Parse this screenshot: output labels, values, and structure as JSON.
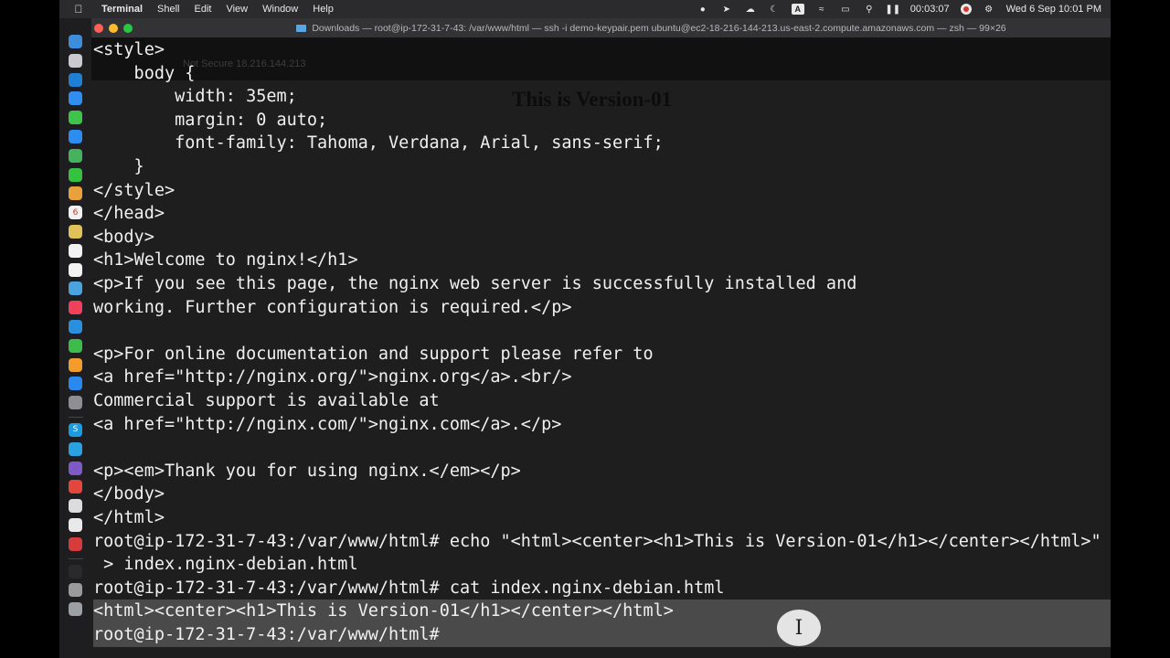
{
  "menubar": {
    "items": [
      "Terminal",
      "Shell",
      "Edit",
      "View",
      "Window",
      "Help"
    ],
    "timer": "00:03:07",
    "datetime": "Wed 6 Sep  10:01 PM",
    "input_source": "A"
  },
  "dock": {
    "icons": [
      {
        "name": "finder-icon",
        "color": "#3e8ddc"
      },
      {
        "name": "launchpad-icon",
        "color": "#c9c9cf"
      },
      {
        "name": "vscode-icon",
        "color": "#1f7fd4"
      },
      {
        "name": "safari-icon",
        "color": "#2f8ef0"
      },
      {
        "name": "messages-icon",
        "color": "#3fc34a"
      },
      {
        "name": "mail-icon",
        "color": "#2d8cf0"
      },
      {
        "name": "maps-icon",
        "color": "#45b35e"
      },
      {
        "name": "facetime-icon",
        "color": "#35c23e"
      },
      {
        "name": "photos-icon",
        "color": "#e9a23b"
      },
      {
        "name": "calendar-icon",
        "color": "#f2f2f2",
        "label": "6"
      },
      {
        "name": "notes-icon",
        "color": "#e0c15a"
      },
      {
        "name": "reminders-icon",
        "color": "#f2f2f2"
      },
      {
        "name": "freeform-icon",
        "color": "#f3f3f3"
      },
      {
        "name": "chrome-icon",
        "color": "#4aa3df"
      },
      {
        "name": "music-icon",
        "color": "#f0415a"
      },
      {
        "name": "keynote-icon",
        "color": "#2b8fe0"
      },
      {
        "name": "numbers-icon",
        "color": "#3dbb4b"
      },
      {
        "name": "pages-icon",
        "color": "#f39b2b"
      },
      {
        "name": "appstore-icon",
        "color": "#2a89ee"
      },
      {
        "name": "settings-icon",
        "color": "#8e8e93"
      },
      {
        "name": "skype-icon",
        "color": "#1b9be0",
        "label": "S"
      },
      {
        "name": "telegram-icon",
        "color": "#2aa1e0"
      },
      {
        "name": "viber-icon",
        "color": "#7d5ac5"
      },
      {
        "name": "anydesk-icon",
        "color": "#e2463d"
      },
      {
        "name": "screen-icon",
        "color": "#dcdcdc"
      },
      {
        "name": "chrome-app-icon",
        "color": "#e9e9e9"
      },
      {
        "name": "presentation-icon",
        "color": "#d83b3b"
      },
      {
        "name": "terminal-icon",
        "color": "#2a2a2a"
      },
      {
        "name": "printer-icon",
        "color": "#9a9a9a"
      },
      {
        "name": "trash-icon",
        "color": "#9aa0a6"
      }
    ]
  },
  "window": {
    "title": "Downloads — root@ip-172-31-7-43: /var/www/html — ssh -i demo-keypair.pem ubuntu@ec2-18-216-144-213.us-east-2.compute.amazonaws.com — zsh — 99×26",
    "colors": {
      "close": "#fe5f57",
      "minimize": "#febc2e",
      "zoom": "#28c840",
      "background": "#1e1e1e",
      "selection": "#4a4a4a"
    }
  },
  "ghost_browser": {
    "url": "Not Secure    18.216.144.213",
    "heading": "This is Version-01"
  },
  "terminal": {
    "lines": [
      "<style>",
      "    body {",
      "        width: 35em;",
      "        margin: 0 auto;",
      "        font-family: Tahoma, Verdana, Arial, sans-serif;",
      "    }",
      "</style>",
      "</head>",
      "<body>",
      "<h1>Welcome to nginx!</h1>",
      "<p>If you see this page, the nginx web server is successfully installed and",
      "working. Further configuration is required.</p>",
      "",
      "<p>For online documentation and support please refer to",
      "<a href=\"http://nginx.org/\">nginx.org</a>.<br/>",
      "Commercial support is available at",
      "<a href=\"http://nginx.com/\">nginx.com</a>.</p>",
      "",
      "<p><em>Thank you for using nginx.</em></p>",
      "</body>",
      "</html>",
      "root@ip-172-31-7-43:/var/www/html# echo \"<html><center><h1>This is Version-01</h1></center></html>\"",
      " > index.nginx-debian.html",
      "root@ip-172-31-7-43:/var/www/html# cat index.nginx-debian.html",
      "<html><center><h1>This is Version-01</h1></center></html>",
      "root@ip-172-31-7-43:/var/www/html# "
    ],
    "selected_lines": [
      24,
      25
    ]
  }
}
